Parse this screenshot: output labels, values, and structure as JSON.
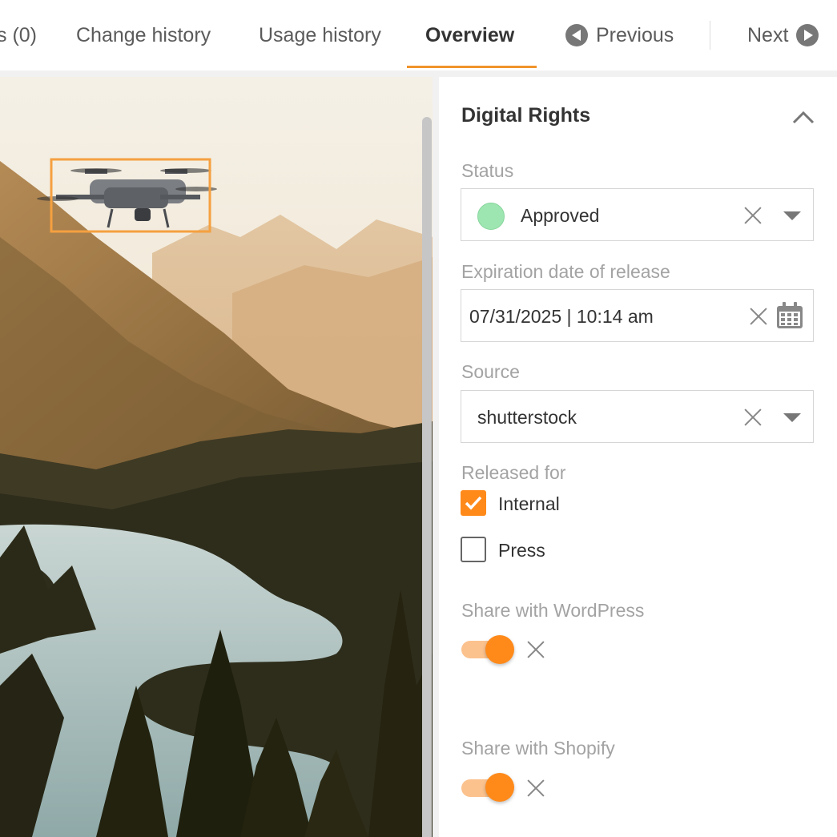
{
  "tabs": [
    {
      "label": "s (0)"
    },
    {
      "label": "Change history"
    },
    {
      "label": "Usage history"
    },
    {
      "label": "Overview"
    }
  ],
  "nav": {
    "previous": "Previous",
    "next": "Next"
  },
  "panel": {
    "title": "Digital Rights",
    "status": {
      "label": "Status",
      "value": "Approved",
      "color": "#9ee6b1"
    },
    "expiration": {
      "label": "Expiration date of release",
      "value": "07/31/2025 | 10:14 am"
    },
    "source": {
      "label": "Source",
      "value": "shutterstock"
    },
    "released_for": {
      "label": "Released for",
      "options": [
        {
          "label": "Internal",
          "checked": true
        },
        {
          "label": "Press",
          "checked": false
        }
      ]
    },
    "wordpress": {
      "label": "Share with WordPress",
      "enabled": true
    },
    "shopify": {
      "label": "Share with Shopify",
      "enabled": true
    }
  },
  "colors": {
    "accent": "#ff8a1a",
    "tab_underline": "#f0932b",
    "selection_box": "#f5a040"
  },
  "icons": [
    "chevron-up-icon",
    "close-icon",
    "chevron-down-icon",
    "calendar-icon",
    "arrow-left-circle-icon",
    "arrow-right-circle-icon"
  ]
}
